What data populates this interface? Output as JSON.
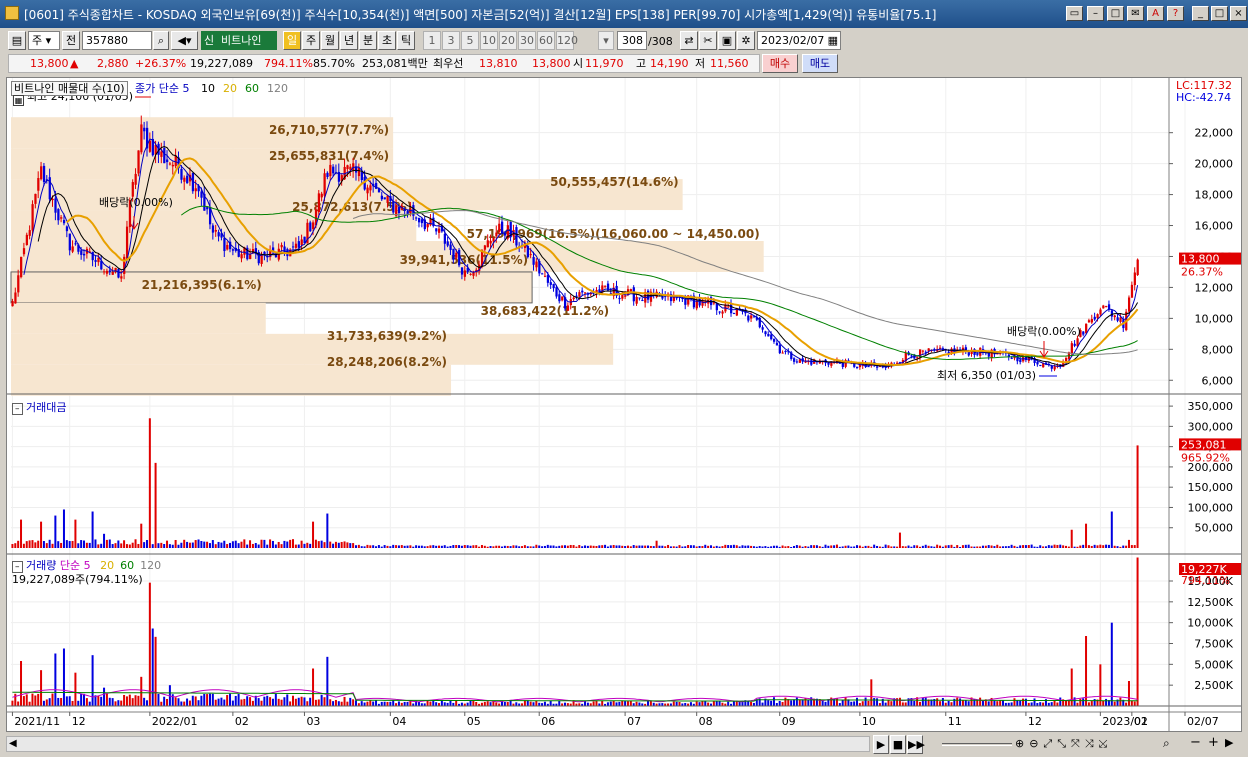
{
  "window": {
    "title": "[0601] 주식종합차트 - KOSDAQ 외국인보유[69(천)] 주식수[10,354(천)] 액면[500] 자본금[52(억)] 결산[12월] EPS[138] PER[99.70] 시가총액[1,429(억)] 유통비율[75.1]"
  },
  "toolbar": {
    "kind_label": "주",
    "prev_label": "전",
    "code": "357880",
    "market_badge": "신",
    "stock_name": "비트나인",
    "period_tabs": [
      "일",
      "주",
      "월",
      "년",
      "분",
      "초",
      "틱"
    ],
    "active_period": "일",
    "interval_buttons": [
      "1",
      "3",
      "5",
      "10",
      "20",
      "30",
      "60",
      "120"
    ],
    "count_value": "308",
    "count_total": "/308",
    "date": "2023/02/07"
  },
  "quote": {
    "price": "13,800",
    "change_arrow": "▲",
    "change": "2,880",
    "change_pct": "+26.37%",
    "volume": "19,227,089",
    "volume_pct": "794.11%",
    "rate": "85.70%",
    "amount": "253,081백만",
    "priority_label": "최우선",
    "bid": "13,810",
    "ask": "13,800",
    "open_label": "시",
    "open": "11,970",
    "high_label": "고",
    "high": "14,190",
    "low_label": "저",
    "low": "11,560",
    "buy_label": "매수",
    "sell_label": "매도"
  },
  "price_panel": {
    "legend_title": "비트나인 매물대 수(10)",
    "ma_label": "종가 단순 5",
    "ma_periods": [
      "10",
      "20",
      "60",
      "120"
    ],
    "lc": "LC:117.32",
    "hc": "HC:-42.74",
    "yaxis": [
      "22,000",
      "20,000",
      "18,000",
      "16,000",
      "14,000",
      "12,000",
      "10,000",
      "8,000",
      "6,000"
    ],
    "current_price": "13,800",
    "current_pct": "26.37%",
    "annotations": {
      "high": "최고 24,100 (01/05)",
      "low": "최저 6,350 (01/03)",
      "dividend1": "배당락(0.00%)",
      "dividend2": "배당락(0.00%)"
    },
    "volume_profile": [
      "26,710,577(7.7%)",
      "25,655,831(7.4%)",
      "50,555,457(14.6%)",
      "25,872,613(7.5%)",
      "57,199,969(16.5%)(16,060.00 ~ 14,450.00)",
      "39,941,536(11.5%)",
      "21,216,395(6.1%)",
      "38,683,422(11.2%)",
      "31,733,639(9.2%)",
      "28,248,206(8.2%)"
    ]
  },
  "amount_panel": {
    "title": "거래대금",
    "yaxis": [
      "350,000",
      "300,000",
      "250,000",
      "200,000",
      "150,000",
      "100,000",
      "50,000"
    ],
    "current": "253,081",
    "current_pct": "965.92%"
  },
  "volume_panel": {
    "title": "거래량",
    "ma_label": "단순 5",
    "ma_periods": [
      "20",
      "60",
      "120"
    ],
    "summary": "19,227,089주(794.11%)",
    "yaxis": [
      "15,000K",
      "12,500K",
      "10,000K",
      "7,500K",
      "5,000K",
      "2,500K"
    ],
    "current": "19,227K",
    "current_pct": "794.11%"
  },
  "xaxis": [
    "2021/11",
    "12",
    "2022/01",
    "02",
    "03",
    "04",
    "05",
    "06",
    "07",
    "08",
    "09",
    "10",
    "11",
    "12",
    "2023/01",
    "02",
    "02/07"
  ],
  "chart_data": [
    {
      "type": "candlestick",
      "title": "비트나인",
      "ylim": [
        5500,
        24500
      ],
      "yunit": "원",
      "ticks": [
        6000,
        8000,
        10000,
        12000,
        14000,
        16000,
        18000,
        20000,
        22000
      ],
      "high": 24100,
      "low": 6350,
      "close": 13800,
      "anchors": [
        [
          0,
          11000
        ],
        [
          3,
          13500
        ],
        [
          10,
          19500
        ],
        [
          20,
          14800
        ],
        [
          35,
          13000
        ],
        [
          38,
          12500
        ],
        [
          40,
          16000
        ],
        [
          45,
          22000
        ],
        [
          52,
          20500
        ],
        [
          58,
          19800
        ],
        [
          65,
          18500
        ],
        [
          70,
          15500
        ],
        [
          78,
          14200
        ],
        [
          88,
          14000
        ],
        [
          100,
          14500
        ],
        [
          105,
          16500
        ],
        [
          110,
          19500
        ],
        [
          116,
          19500
        ],
        [
          122,
          19200
        ],
        [
          130,
          17500
        ],
        [
          140,
          16800
        ],
        [
          150,
          15300
        ],
        [
          158,
          13000
        ],
        [
          162,
          13500
        ],
        [
          168,
          15500
        ],
        [
          172,
          15800
        ],
        [
          180,
          14200
        ],
        [
          188,
          12000
        ],
        [
          193,
          11000
        ],
        [
          197,
          11500
        ],
        [
          205,
          11800
        ],
        [
          220,
          11400
        ],
        [
          235,
          11200
        ],
        [
          245,
          10800
        ],
        [
          255,
          10300
        ],
        [
          262,
          9500
        ],
        [
          268,
          8000
        ],
        [
          275,
          7200
        ],
        [
          285,
          7200
        ],
        [
          298,
          6900
        ],
        [
          305,
          6800
        ],
        [
          312,
          7600
        ],
        [
          320,
          7800
        ],
        [
          330,
          7900
        ],
        [
          340,
          7800
        ],
        [
          350,
          7500
        ],
        [
          358,
          7200
        ],
        [
          362,
          6900
        ],
        [
          366,
          7100
        ],
        [
          370,
          8200
        ],
        [
          375,
          9500
        ],
        [
          380,
          10800
        ],
        [
          385,
          10200
        ],
        [
          388,
          9700
        ],
        [
          390,
          11500
        ],
        [
          393,
          13800
        ]
      ],
      "moving_averages": [
        "5",
        "10",
        "20",
        "60",
        "120"
      ]
    },
    {
      "type": "bar",
      "title": "거래대금",
      "ylim": [
        0,
        370000
      ],
      "ticks": [
        50000,
        100000,
        150000,
        200000,
        250000,
        300000,
        350000
      ],
      "last": 253081
    },
    {
      "type": "bar",
      "title": "거래량",
      "ylim": [
        0,
        18000000
      ],
      "ticks": [
        2500000,
        5000000,
        7500000,
        10000000,
        12500000,
        15000000
      ],
      "last": 19227089
    }
  ],
  "status": {
    "zoom_icons": [
      "−",
      "+"
    ]
  },
  "colors": {
    "up": "#e00000",
    "down": "#0000e0",
    "ma5": "#0000c0",
    "ma10": "#000000",
    "ma20": "#e8a000",
    "ma60": "#008000",
    "ma120": "#808080",
    "profile": "#f7e6d0"
  }
}
